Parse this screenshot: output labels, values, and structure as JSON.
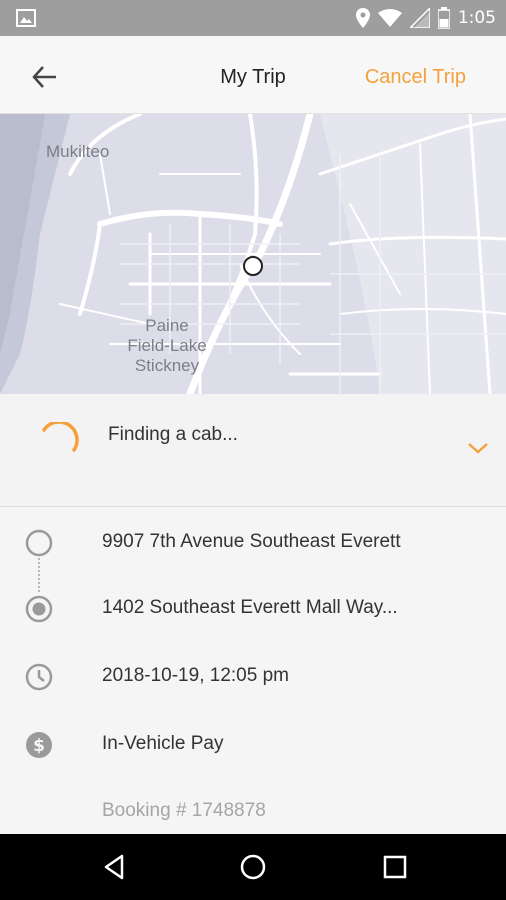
{
  "status_bar": {
    "time": "1:05",
    "icons": [
      "image-icon",
      "location-icon",
      "wifi-icon",
      "signal-icon",
      "battery-icon"
    ]
  },
  "header": {
    "title": "My Trip",
    "cancel_label": "Cancel Trip",
    "back_icon": "back-arrow-icon"
  },
  "map": {
    "labels": {
      "mukilteo": "Mukilteo",
      "paine": "Paine\nField-Lake\nStickney"
    }
  },
  "status": {
    "text": "Finding a cab...",
    "accent_color": "#f5a13b"
  },
  "trip": {
    "pickup": "9907 7th Avenue Southeast Everett",
    "dropoff": "1402 Southeast Everett Mall Way...",
    "datetime": "2018-10-19, 12:05 pm",
    "payment": "In-Vehicle Pay",
    "booking": "Booking # 1748878"
  },
  "colors": {
    "accent": "#f5a13b",
    "status_bar": "#9e9e9e",
    "map_bg": "#dcdde8"
  }
}
